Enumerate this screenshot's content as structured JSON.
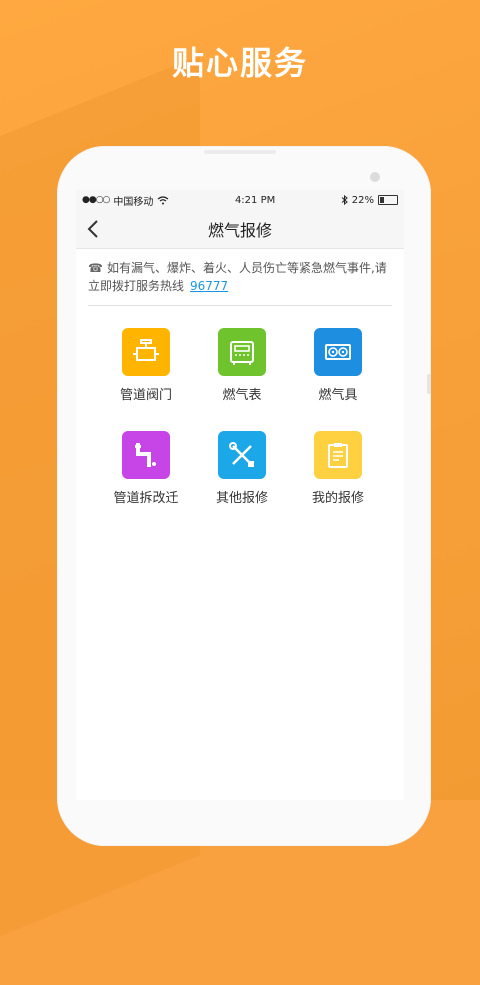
{
  "promo": {
    "headline": "贴心服务"
  },
  "status_bar": {
    "signal": "●●○○",
    "carrier": "中国移动",
    "time": "4:21 PM",
    "battery": "22%"
  },
  "nav": {
    "title": "燃气报修"
  },
  "notice": {
    "text": "如有漏气、爆炸、着火、人员伤亡等紧急燃气事件,请立即拨打服务热线",
    "hotline": "96777"
  },
  "menu": [
    {
      "label": "管道阀门",
      "color": "#FFB400",
      "icon": "pipe-valve-icon"
    },
    {
      "label": "燃气表",
      "color": "#6FC42D",
      "icon": "gas-meter-icon"
    },
    {
      "label": "燃气具",
      "color": "#1E8FE0",
      "icon": "gas-stove-icon"
    },
    {
      "label": "管道拆改迁",
      "color": "#C744E6",
      "icon": "pipe-relocate-icon"
    },
    {
      "label": "其他报修",
      "color": "#1CA7E8",
      "icon": "tools-icon"
    },
    {
      "label": "我的报修",
      "color": "#FFD040",
      "icon": "clipboard-icon"
    }
  ]
}
